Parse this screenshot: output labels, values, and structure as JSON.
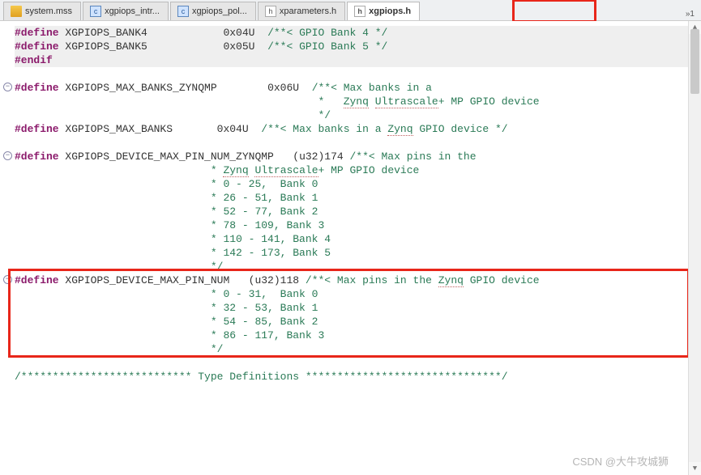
{
  "tabs": [
    {
      "label": "system.mss",
      "icon": "mss"
    },
    {
      "label": "xgpiops_intr...",
      "icon": "c"
    },
    {
      "label": "xgpiops_pol...",
      "icon": "c"
    },
    {
      "label": "xparameters.h",
      "icon": "h"
    },
    {
      "label": "xgpiops.h",
      "icon": "h",
      "active": true
    }
  ],
  "overflow": "»1",
  "code": {
    "l1_kw": "#define",
    "l1_id": " XGPIOPS_BANK4",
    "l1_val": "0x04U",
    "l1_cm": "/**< GPIO Bank 4 */",
    "l2_kw": "#define",
    "l2_id": " XGPIOPS_BANK5",
    "l2_val": "0x05U",
    "l2_cm": "/**< GPIO Bank 5 */",
    "l3_kw": "#endif",
    "l5_kw": "#define",
    "l5_id": " XGPIOPS_MAX_BANKS_ZYNQMP",
    "l5_val": "0x06U",
    "l5_cm1": "/**< Max banks in a",
    "l6_cm": " *   ",
    "l6_link1": "Zynq",
    "l6_sp": " ",
    "l6_link2": "Ultrascale",
    "l6_cm2": "+ MP GPIO device",
    "l7_cm": " */",
    "l8_kw": "#define",
    "l8_id": " XGPIOPS_MAX_BANKS",
    "l8_val": "0x04U",
    "l8_cm1": "/**< Max banks in a ",
    "l8_link": "Zynq",
    "l8_cm2": " GPIO device */",
    "l10_kw": "#define",
    "l10_id": " XGPIOPS_DEVICE_MAX_PIN_NUM_ZYNQMP",
    "l10_val": "(u32)174",
    "l10_cm": "/**< Max pins in the",
    "l11_cm1": "                               * ",
    "l11_link1": "Zynq",
    "l11_sp": " ",
    "l11_link2": "Ultrascale",
    "l11_cm2": "+ MP GPIO device",
    "l12_cm": "                               * 0 - 25,  Bank 0",
    "l13_cm": "                               * 26 - 51, Bank 1",
    "l14_cm": "                               * 52 - 77, Bank 2",
    "l15_cm": "                               * 78 - 109, Bank 3",
    "l16_cm": "                               * 110 - 141, Bank 4",
    "l17_cm": "                               * 142 - 173, Bank 5",
    "l18_cm": "                               */",
    "l19_kw": "#define",
    "l19_id": " XGPIOPS_DEVICE_MAX_PIN_NUM",
    "l19_val": "(u32)118",
    "l19_cm1": "/**< Max pins in the ",
    "l19_link": "Zynq",
    "l19_cm2": " GPIO device",
    "l20_cm": "                               * 0 - 31,  Bank 0",
    "l21_cm": "                               * 32 - 53, Bank 1",
    "l22_cm": "                               * 54 - 85, Bank 2",
    "l23_cm": "                               * 86 - 117, Bank 3",
    "l24_cm": "                               */",
    "l26_cm": "/*************************** Type Definitions *******************************/"
  },
  "watermark": "CSDN @大牛攻城狮"
}
